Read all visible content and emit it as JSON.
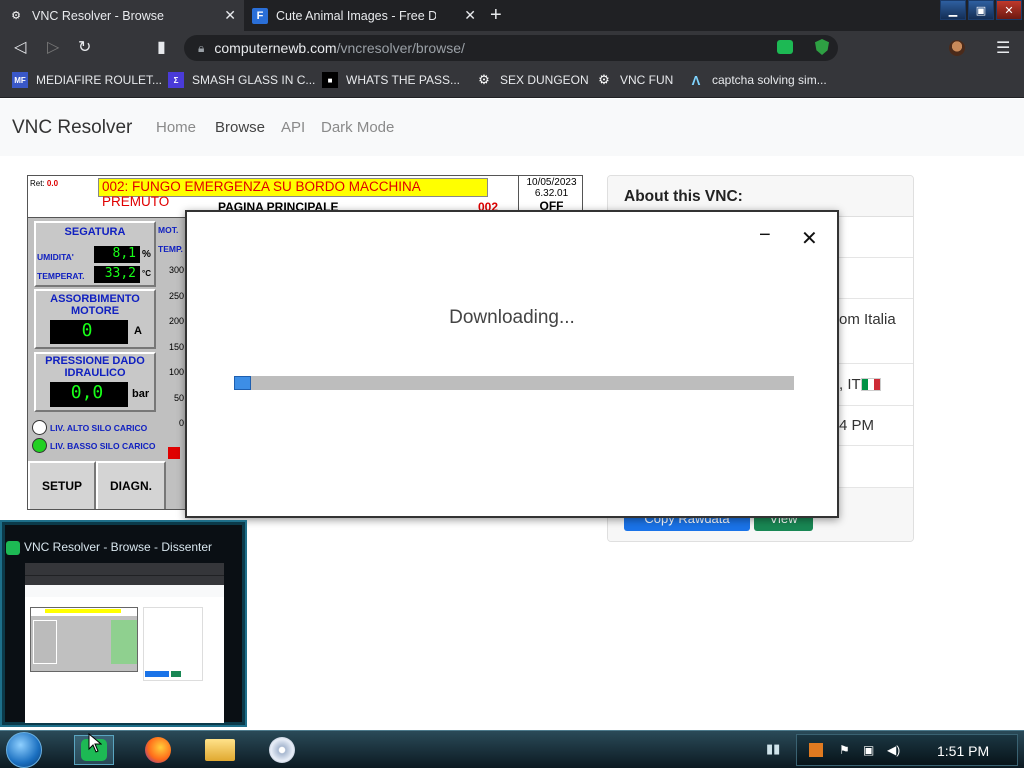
{
  "tabs": [
    {
      "title": "VNC Resolver - Browse",
      "close": "✕"
    },
    {
      "title": "Cute Animal Images - Free Download",
      "close": "✕",
      "favicon": "F"
    }
  ],
  "newtab": "+",
  "address": {
    "host": "computernewb.com",
    "path": "/vncresolver/browse/"
  },
  "bookmarks": [
    {
      "label": "MEDIAFIRE ROULET...",
      "icon": "MF"
    },
    {
      "label": "SMASH GLASS IN C...",
      "icon": "Σ"
    },
    {
      "label": "WHATS THE PASS...",
      "icon": "■"
    },
    {
      "label": "SEX DUNGEON",
      "icon": "⚙"
    },
    {
      "label": "VNC FUN",
      "icon": "⚙"
    },
    {
      "label": "captcha solving sim...",
      "icon": "Λ"
    }
  ],
  "navbar": {
    "brand": "VNC Resolver",
    "links": [
      "Home",
      "Browse",
      "API",
      "Dark Mode"
    ]
  },
  "hmi": {
    "ret_label": "Ret:",
    "ret_value": "0.0",
    "alarm": "002: FUNGO EMERGENZA SU BORDO MACCHINA PREMUTO",
    "page": "PAGINA PRINCIPALE",
    "code": "002",
    "date": "10/05/2023",
    "version": "6.32.01",
    "state": "OFF",
    "segatura": "SEGATURA",
    "umidita_label": "UMIDITA'",
    "umidita": "8,1",
    "umidita_unit": "%",
    "temp_label": "TEMPERAT.",
    "temp": "33,2",
    "temp_unit": "°C",
    "assorbimento": "ASSORBIMENTO MOTORE",
    "amp": "0",
    "amp_unit": "A",
    "pressione": "PRESSIONE DADO IDRAULICO",
    "bar": "0,0",
    "bar_unit": "bar",
    "liv_alto": "LIV. ALTO SILO CARICO",
    "liv_basso": "LIV. BASSO SILO CARICO",
    "mot": "MOT.",
    "temp_short": "TEMP.",
    "scale": [
      "300",
      "250",
      "200",
      "150",
      "100",
      "50",
      "0"
    ],
    "setup": "SETUP",
    "diagn": "DIAGN."
  },
  "card": {
    "header": "About this VNC:",
    "org_fragment": "om Italia",
    "location_fragment": ", IT",
    "time_fragment": "4 PM",
    "copy_btn": "Copy Rawdata",
    "view_btn": "View"
  },
  "dialog": {
    "text": "Downloading...",
    "minimize": "−",
    "close": "✕",
    "progress": 0.03
  },
  "thumbnail": {
    "title": "VNC Resolver - Browse - Dissenter"
  },
  "taskbar": {
    "clock": "1:51 PM"
  },
  "colors": {
    "accent_blue": "#1a73e8",
    "success_green": "#198754",
    "alarm_yellow": "#ffff00"
  }
}
